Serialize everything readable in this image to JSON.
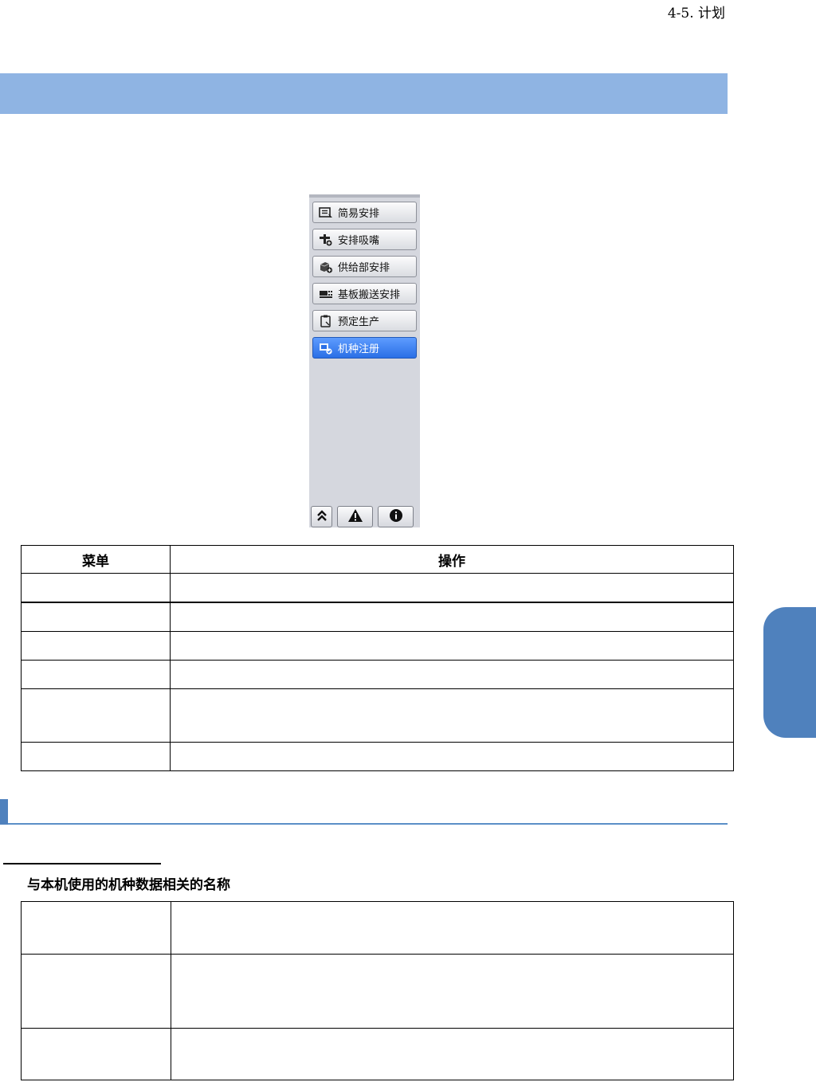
{
  "header": {
    "section": "4-5. 计划"
  },
  "menu_panel": {
    "items": [
      {
        "label": "简易安排",
        "icon": "simple-schedule-icon"
      },
      {
        "label": "安排吸嘴",
        "icon": "nozzle-add-icon"
      },
      {
        "label": "供给部安排",
        "icon": "feeder-add-icon"
      },
      {
        "label": "基板搬送安排",
        "icon": "board-transfer-icon"
      },
      {
        "label": "预定生产",
        "icon": "clipboard-icon"
      },
      {
        "label": "机种注册",
        "icon": "model-register-icon"
      }
    ],
    "active_index": 5,
    "bottom_buttons": [
      "double-chevron-up-icon",
      "warning-icon",
      "info-icon"
    ]
  },
  "menu_table": {
    "headers": [
      "菜单",
      "操作"
    ]
  },
  "terms": {
    "heading": "与本机使用的机种数据相关的名称"
  },
  "colors": {
    "title_bar": "#8fb4e3",
    "accent": "#4f81bd",
    "active_button": "#2a6fe6"
  }
}
